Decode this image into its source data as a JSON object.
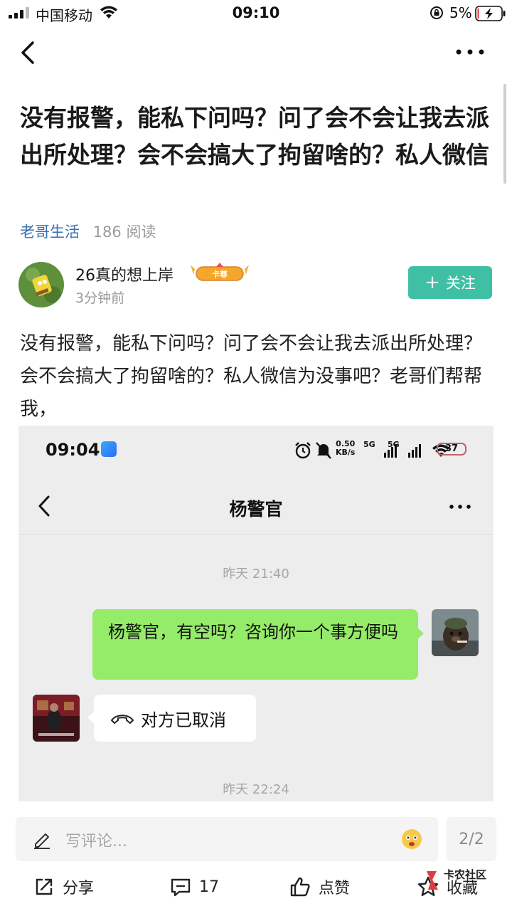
{
  "status_bar": {
    "carrier": "中国移动",
    "time": "09:10",
    "battery_percent": "5%",
    "battery_level": 0.05,
    "icons": [
      "signal-icon",
      "wifi-icon",
      "orientation-lock-icon",
      "battery-charging-icon"
    ]
  },
  "nav": {
    "back_icon": "chevron-left-icon",
    "more_icon": "more-horizontal-icon"
  },
  "post": {
    "title": "没有报警，能私下问吗？问了会不会让我去派出所处理？会不会搞大了拘留啥的？私人微信",
    "community": "老哥生活",
    "reads": "186 阅读",
    "author": {
      "name": "26真的想上岸",
      "badge_label": "卡尊",
      "time": "3分钟前"
    },
    "follow_label": "关注",
    "body": "没有报警，能私下问吗？问了会不会让我去派出所处理？会不会搞大了拘留啥的？私人微信为没事吧？老哥们帮帮我，"
  },
  "screenshot": {
    "time": "09:04",
    "net_speed_value": "0.50",
    "net_speed_unit": "KB/s",
    "network_a": "5G",
    "network_b": "5G",
    "battery": "37",
    "contact": "杨警官",
    "timestamp_1": "昨天 21:40",
    "outgoing_message": "杨警官，有空吗？咨询你一个事方便吗",
    "incoming_call_status": "对方已取消",
    "timestamp_2": "昨天 22:24"
  },
  "comment_bar": {
    "placeholder": "写评论...",
    "page_indicator": "2/2"
  },
  "actions": {
    "share": "分享",
    "comments": "17",
    "like": "点赞",
    "favorite": "收藏"
  },
  "watermark": "卡农社区",
  "colors": {
    "accent_teal": "#3fbfa4",
    "community_link": "#3a6fb0",
    "chat_bubble_green": "#95ec69",
    "chat_background": "#ededed"
  }
}
